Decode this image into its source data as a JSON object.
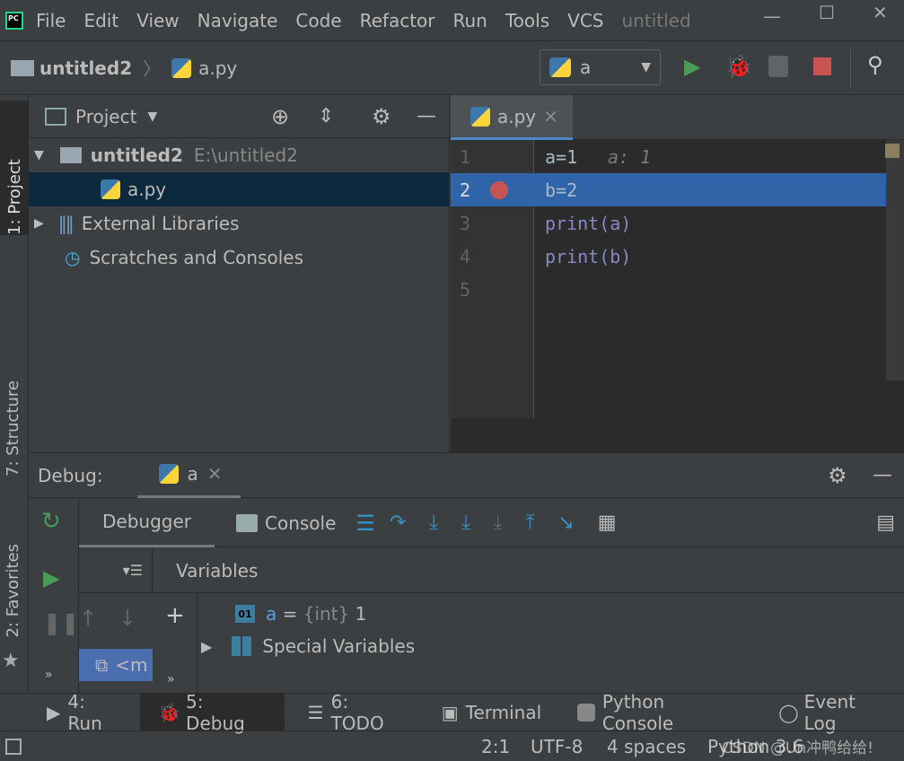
{
  "menu": {
    "items": [
      "File",
      "Edit",
      "View",
      "Navigate",
      "Code",
      "Refactor",
      "Run",
      "Tools",
      "VCS"
    ],
    "title": "untitled"
  },
  "nav": {
    "project": "untitled2",
    "file": "a.py",
    "run_config": "a"
  },
  "project_panel": {
    "title": "Project",
    "root": "untitled2",
    "root_path": "E:\\untitled2",
    "file": "a.py",
    "external": "External Libraries",
    "scratches": "Scratches and Consoles"
  },
  "left_strip": {
    "project": "1: Project",
    "structure": "7: Structure",
    "favorites": "2: Favorites"
  },
  "editor": {
    "tab": "a.py",
    "lines": [
      {
        "num": "1",
        "code": "a=1",
        "hint": "a: 1"
      },
      {
        "num": "2",
        "code": "b=2",
        "hint": ""
      },
      {
        "num": "3",
        "code": "print(a)",
        "hint": ""
      },
      {
        "num": "4",
        "code": "print(b)",
        "hint": ""
      },
      {
        "num": "5",
        "code": "",
        "hint": ""
      }
    ],
    "breakpoint_line": 2,
    "current_line": 2
  },
  "debug": {
    "label": "Debug:",
    "session": "a",
    "tabs": [
      "Debugger",
      "Console"
    ],
    "variables_header": "Variables",
    "frame": "<m",
    "variables": [
      {
        "name": "a",
        "eq": " = ",
        "type": "{int}",
        "value": " 1"
      },
      {
        "name": "Special Variables"
      }
    ]
  },
  "bottom_tabs": [
    "4: Run",
    "5: Debug",
    "6: TODO",
    "Terminal",
    "Python Console",
    "Event Log"
  ],
  "status": {
    "position": "2:1",
    "encoding": "UTF-8",
    "indent": "4 spaces",
    "interpreter": "Python 3.6",
    "watermark": "CSDN @Un冲鸭给给!"
  },
  "colors": {
    "accent": "#2f65a8",
    "breakpoint": "#c75450",
    "run": "#499c54",
    "selection": "#0d293e"
  }
}
